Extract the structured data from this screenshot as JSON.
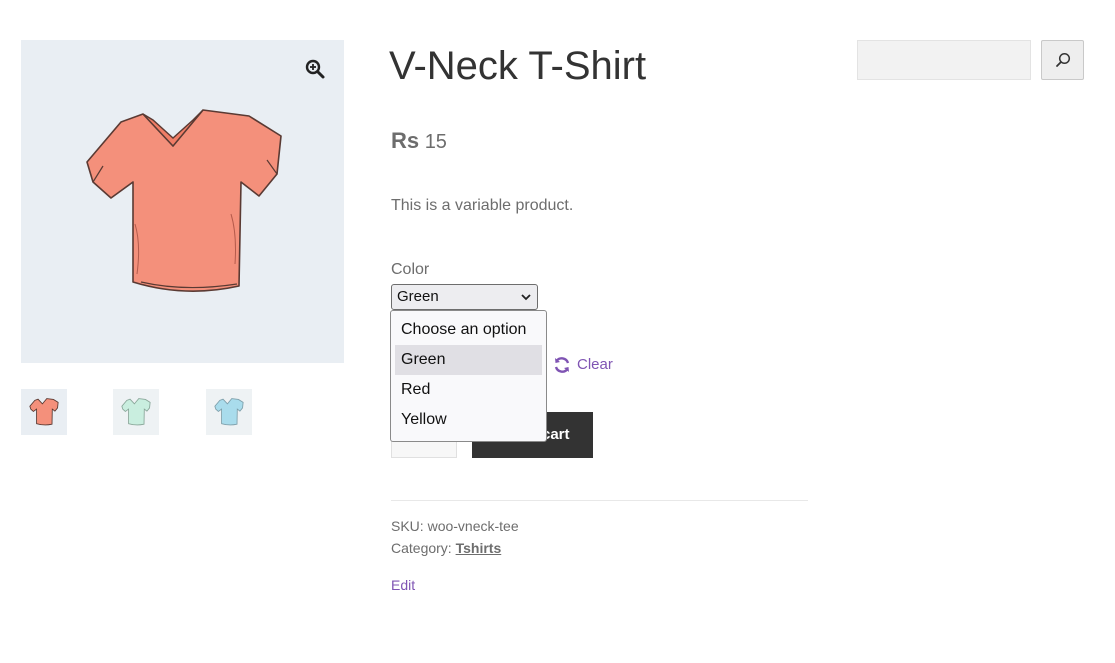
{
  "product": {
    "title": "V-Neck T-Shirt",
    "price_currency": "Rs",
    "price_amount": "15",
    "short_description": "This is a variable product."
  },
  "gallery": {
    "main_image_color": "#f4907b",
    "thumbnails": [
      {
        "color": "#f4907b"
      },
      {
        "color": "#c9eedf"
      },
      {
        "color": "#a9dcec"
      }
    ],
    "zoom_icon": "magnifier-plus-icon"
  },
  "variation": {
    "label": "Color",
    "selected_value": "Green",
    "options": [
      "Choose an option",
      "Green",
      "Red",
      "Yellow"
    ],
    "highlighted_option": "Green",
    "reset_label": "Clear",
    "reset_icon": "refresh-icon"
  },
  "cart": {
    "button_label": "Add to cart",
    "visible_fragment": "cart"
  },
  "meta": {
    "sku_label": "SKU:",
    "sku_value": "woo-vneck-tee",
    "category_label": "Category:",
    "category_value": "Tshirts",
    "edit_label": "Edit"
  },
  "search": {
    "value": "",
    "button_icon": "search-icon"
  },
  "colors": {
    "accent": "#7f54b3",
    "button_bg": "#333333",
    "image_bg": "#e9eef3"
  }
}
